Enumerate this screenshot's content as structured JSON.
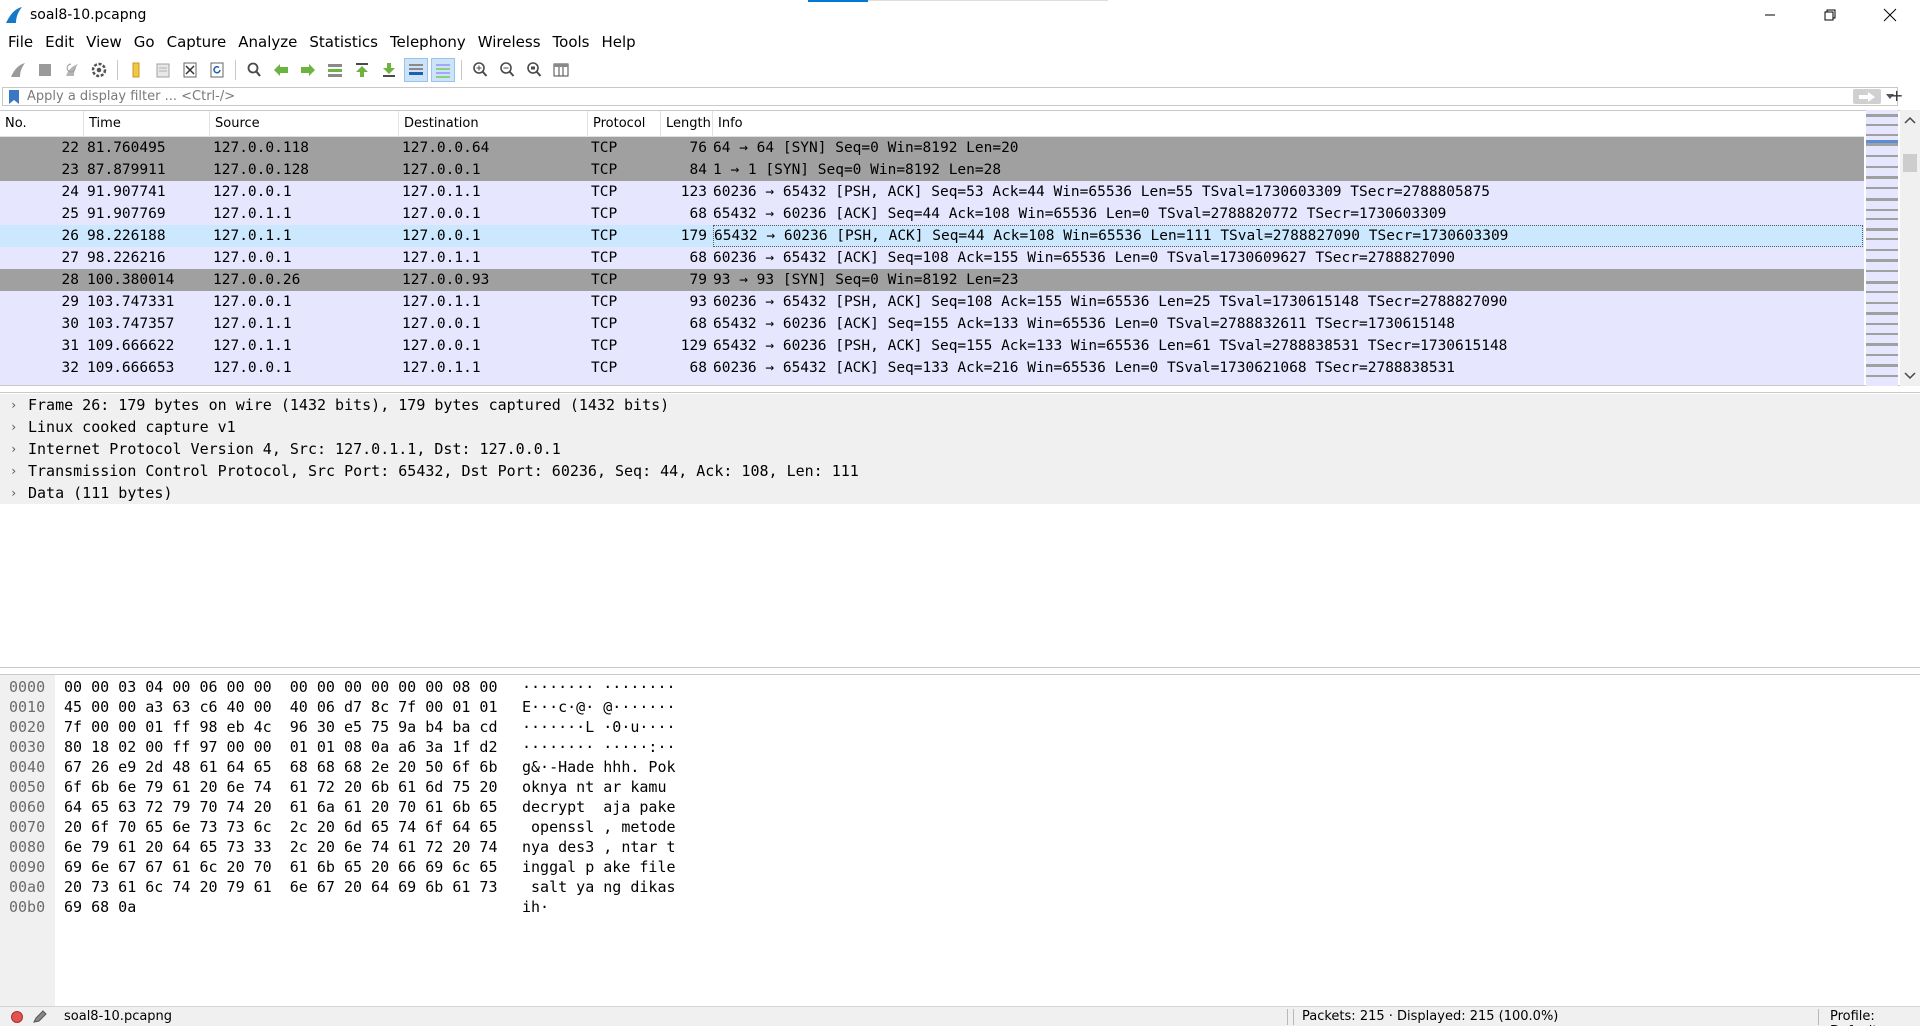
{
  "window": {
    "title": "soal8-10.pcapng"
  },
  "menu": [
    "File",
    "Edit",
    "View",
    "Go",
    "Capture",
    "Analyze",
    "Statistics",
    "Telephony",
    "Wireless",
    "Tools",
    "Help"
  ],
  "filter": {
    "placeholder": "Apply a display filter ... <Ctrl-/>"
  },
  "columns": [
    "No.",
    "Time",
    "Source",
    "Destination",
    "Protocol",
    "Length",
    "Info"
  ],
  "packets": [
    {
      "no": "22",
      "time": "81.760495",
      "src": "127.0.0.118",
      "dst": "127.0.0.64",
      "proto": "TCP",
      "len": "76",
      "info": "64 → 64 [SYN] Seq=0 Win=8192 Len=20",
      "style": "syn"
    },
    {
      "no": "23",
      "time": "87.879911",
      "src": "127.0.0.128",
      "dst": "127.0.0.1",
      "proto": "TCP",
      "len": "84",
      "info": "1 → 1 [SYN] Seq=0 Win=8192 Len=28",
      "style": "syn"
    },
    {
      "no": "24",
      "time": "91.907741",
      "src": "127.0.0.1",
      "dst": "127.0.1.1",
      "proto": "TCP",
      "len": "123",
      "info": "60236 → 65432 [PSH, ACK] Seq=53 Ack=44 Win=65536 Len=55 TSval=1730603309 TSecr=2788805875",
      "style": "tcp"
    },
    {
      "no": "25",
      "time": "91.907769",
      "src": "127.0.1.1",
      "dst": "127.0.0.1",
      "proto": "TCP",
      "len": "68",
      "info": "65432 → 60236 [ACK] Seq=44 Ack=108 Win=65536 Len=0 TSval=2788820772 TSecr=1730603309",
      "style": "tcp"
    },
    {
      "no": "26",
      "time": "98.226188",
      "src": "127.0.1.1",
      "dst": "127.0.0.1",
      "proto": "TCP",
      "len": "179",
      "info": "65432 → 60236 [PSH, ACK] Seq=44 Ack=108 Win=65536 Len=111 TSval=2788827090 TSecr=1730603309",
      "style": "sel"
    },
    {
      "no": "27",
      "time": "98.226216",
      "src": "127.0.0.1",
      "dst": "127.0.1.1",
      "proto": "TCP",
      "len": "68",
      "info": "60236 → 65432 [ACK] Seq=108 Ack=155 Win=65536 Len=0 TSval=1730609627 TSecr=2788827090",
      "style": "tcp"
    },
    {
      "no": "28",
      "time": "100.380014",
      "src": "127.0.0.26",
      "dst": "127.0.0.93",
      "proto": "TCP",
      "len": "79",
      "info": "93 → 93 [SYN] Seq=0 Win=8192 Len=23",
      "style": "syn"
    },
    {
      "no": "29",
      "time": "103.747331",
      "src": "127.0.0.1",
      "dst": "127.0.1.1",
      "proto": "TCP",
      "len": "93",
      "info": "60236 → 65432 [PSH, ACK] Seq=108 Ack=155 Win=65536 Len=25 TSval=1730615148 TSecr=2788827090",
      "style": "tcp"
    },
    {
      "no": "30",
      "time": "103.747357",
      "src": "127.0.1.1",
      "dst": "127.0.0.1",
      "proto": "TCP",
      "len": "68",
      "info": "65432 → 60236 [ACK] Seq=155 Ack=133 Win=65536 Len=0 TSval=2788832611 TSecr=1730615148",
      "style": "tcp"
    },
    {
      "no": "31",
      "time": "109.666622",
      "src": "127.0.1.1",
      "dst": "127.0.0.1",
      "proto": "TCP",
      "len": "129",
      "info": "65432 → 60236 [PSH, ACK] Seq=155 Ack=133 Win=65536 Len=61 TSval=2788838531 TSecr=1730615148",
      "style": "tcp"
    },
    {
      "no": "32",
      "time": "109.666653",
      "src": "127.0.0.1",
      "dst": "127.0.1.1",
      "proto": "TCP",
      "len": "68",
      "info": "60236 → 65432 [ACK] Seq=133 Ack=216 Win=65536 Len=0 TSval=1730621068 TSecr=2788838531",
      "style": "tcp"
    }
  ],
  "details": [
    "Frame 26: 179 bytes on wire (1432 bits), 179 bytes captured (1432 bits)",
    "Linux cooked capture v1",
    "Internet Protocol Version 4, Src: 127.0.1.1, Dst: 127.0.0.1",
    "Transmission Control Protocol, Src Port: 65432, Dst Port: 60236, Seq: 44, Ack: 108, Len: 111",
    "Data (111 bytes)"
  ],
  "bytes": [
    {
      "off": "0000",
      "hex": "00 00 03 04 00 06 00 00  00 00 00 00 00 00 08 00",
      "ascii": "········ ········"
    },
    {
      "off": "0010",
      "hex": "45 00 00 a3 63 c6 40 00  40 06 d7 8c 7f 00 01 01",
      "ascii": "E···c·@· @·······"
    },
    {
      "off": "0020",
      "hex": "7f 00 00 01 ff 98 eb 4c  96 30 e5 75 9a b4 ba cd",
      "ascii": "·······L ·0·u····"
    },
    {
      "off": "0030",
      "hex": "80 18 02 00 ff 97 00 00  01 01 08 0a a6 3a 1f d2",
      "ascii": "········ ·····:··"
    },
    {
      "off": "0040",
      "hex": "67 26 e9 2d 48 61 64 65  68 68 68 2e 20 50 6f 6b",
      "ascii": "g&·-Hade hhh. Pok"
    },
    {
      "off": "0050",
      "hex": "6f 6b 6e 79 61 20 6e 74  61 72 20 6b 61 6d 75 20",
      "ascii": "oknya nt ar kamu "
    },
    {
      "off": "0060",
      "hex": "64 65 63 72 79 70 74 20  61 6a 61 20 70 61 6b 65",
      "ascii": "decrypt  aja pake"
    },
    {
      "off": "0070",
      "hex": "20 6f 70 65 6e 73 73 6c  2c 20 6d 65 74 6f 64 65",
      "ascii": " openssl , metode"
    },
    {
      "off": "0080",
      "hex": "6e 79 61 20 64 65 73 33  2c 20 6e 74 61 72 20 74",
      "ascii": "nya des3 , ntar t"
    },
    {
      "off": "0090",
      "hex": "69 6e 67 67 61 6c 20 70  61 6b 65 20 66 69 6c 65",
      "ascii": "inggal p ake file"
    },
    {
      "off": "00a0",
      "hex": "20 73 61 6c 74 20 79 61  6e 67 20 64 69 6b 61 73",
      "ascii": " salt ya ng dikas"
    },
    {
      "off": "00b0",
      "hex": "69 68 0a",
      "ascii": "ih·"
    }
  ],
  "status": {
    "file": "soal8-10.pcapng",
    "packets": "Packets: 215 · Displayed: 215 (100.0%)",
    "profile": "Profile: Default"
  },
  "colors": {
    "syn_row": "#a0a0a0",
    "tcp_row": "#e7e6ff",
    "selected_row": "#cce8ff"
  },
  "toolbar_icons": [
    "shark-fin-start-icon",
    "stop-icon",
    "restart-icon",
    "options-gear-icon",
    "open-folder-icon",
    "save-file-icon",
    "close-file-icon",
    "reload-icon",
    "find-icon",
    "back-arrow-icon",
    "forward-arrow-icon",
    "go-to-packet-icon",
    "first-packet-icon",
    "last-packet-icon",
    "autoscroll-icon",
    "colorize-icon",
    "zoom-in-icon",
    "zoom-out-icon",
    "normal-size-icon",
    "resize-columns-icon"
  ]
}
